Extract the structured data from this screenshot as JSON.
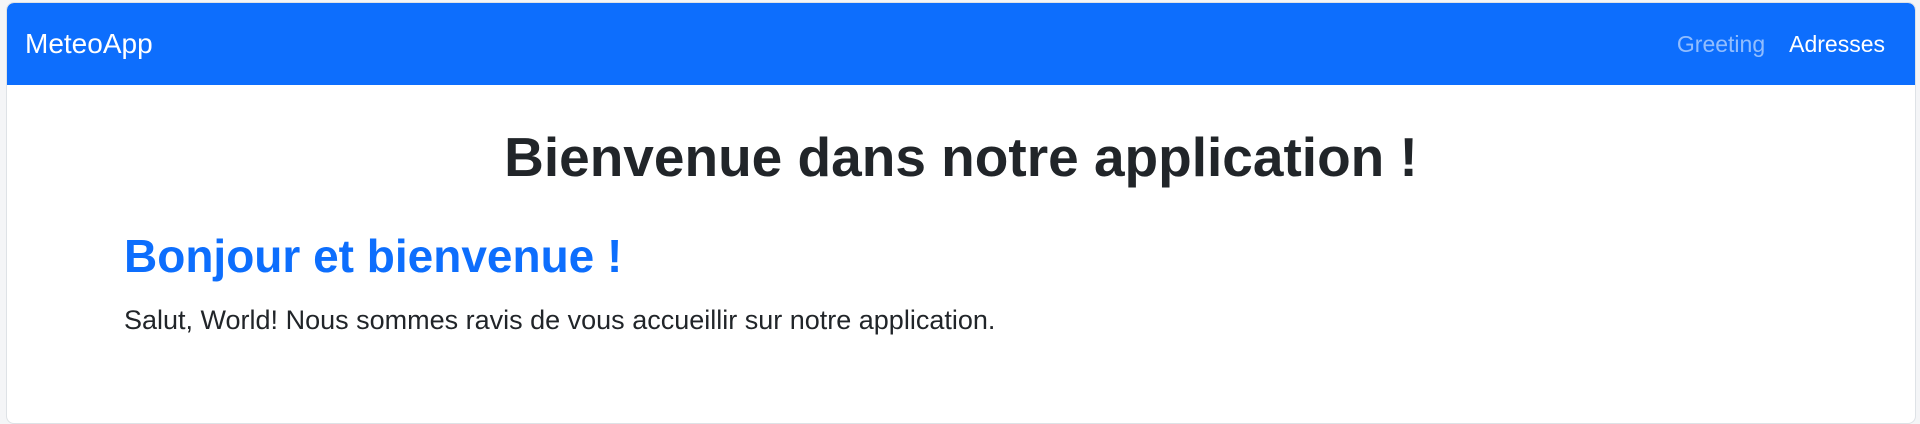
{
  "navbar": {
    "brand": "MeteoApp",
    "links": [
      {
        "label": "Greeting",
        "state": "inactive"
      },
      {
        "label": "Adresses",
        "state": "active"
      }
    ]
  },
  "main": {
    "title": "Bienvenue dans notre application !",
    "greeting": {
      "heading": "Bonjour et bienvenue !",
      "text": "Salut, World! Nous sommes ravis de vous accueillir sur notre application."
    }
  },
  "colors": {
    "primary": "#0d6efd",
    "text": "#212529",
    "background": "#ffffff"
  }
}
